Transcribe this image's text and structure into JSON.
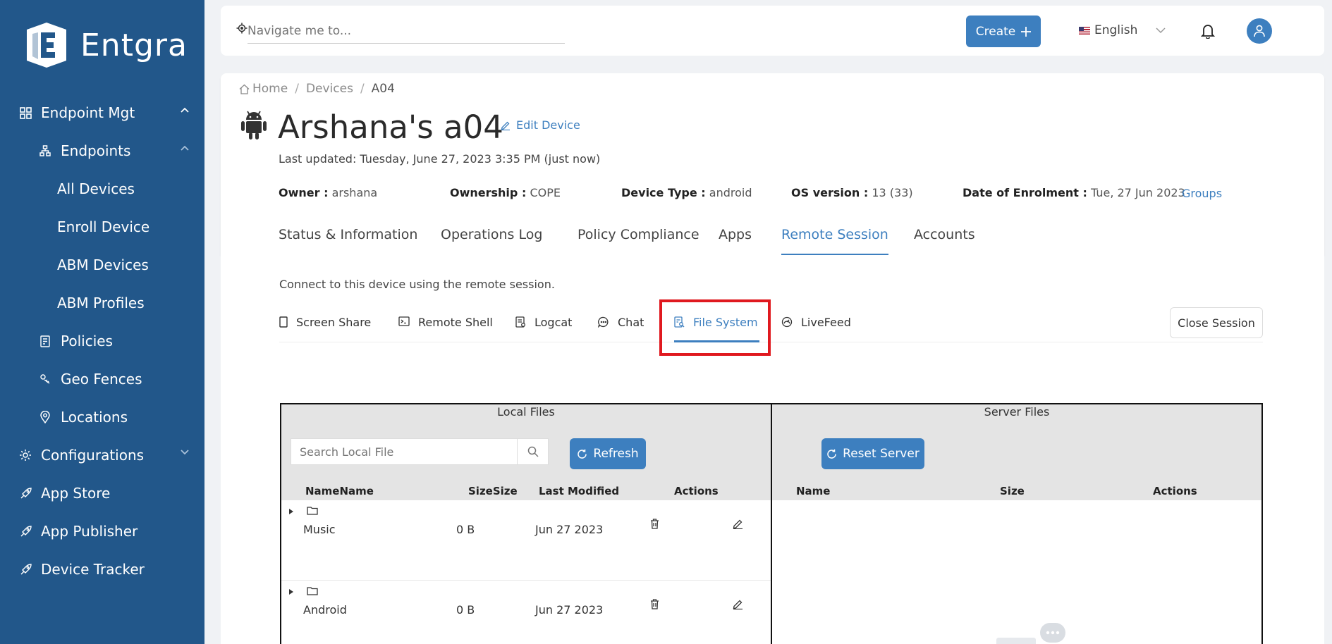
{
  "brand": {
    "name": "Entgra"
  },
  "sidebar": {
    "items": [
      {
        "label": "Endpoint Mgt",
        "icon": "grid-icon"
      },
      {
        "label": "Endpoints",
        "icon": "sitemap-icon"
      },
      {
        "label": "All Devices"
      },
      {
        "label": "Enroll Device"
      },
      {
        "label": "ABM Devices"
      },
      {
        "label": "ABM Profiles"
      },
      {
        "label": "Policies",
        "icon": "policy-icon"
      },
      {
        "label": "Geo Fences",
        "icon": "geofence-icon"
      },
      {
        "label": "Locations",
        "icon": "location-pin-icon"
      },
      {
        "label": "Configurations",
        "icon": "gear-icon"
      },
      {
        "label": "App Store",
        "icon": "rocket-icon"
      },
      {
        "label": "App Publisher",
        "icon": "rocket-icon"
      },
      {
        "label": "Device Tracker",
        "icon": "rocket-icon"
      }
    ]
  },
  "topbar": {
    "search_placeholder": "Navigate me to...",
    "create_label": "Create",
    "language": "English"
  },
  "breadcrumb": {
    "home": "Home",
    "devices": "Devices",
    "current": "A04"
  },
  "device": {
    "title": "Arshana's a04",
    "edit_label": "Edit Device",
    "last_updated": "Last updated: Tuesday, June 27, 2023 3:35 PM (just now)",
    "owner_label": "Owner :",
    "owner": "arshana",
    "ownership_label": "Ownership :",
    "ownership": "COPE",
    "type_label": "Device Type :",
    "type": "android",
    "os_label": "OS version :",
    "os": "13 (33)",
    "enrolment_label": "Date of Enrolment :",
    "enrolment": "Tue, 27 Jun 2023",
    "groups_label": "Groups"
  },
  "tabs": [
    "Status & Information",
    "Operations Log",
    "Policy Compliance",
    "Apps",
    "Remote Session",
    "Accounts"
  ],
  "active_tab": "Remote Session",
  "session": {
    "description": "Connect to this device using the remote session.",
    "sub_tabs": [
      "Screen Share",
      "Remote Shell",
      "Logcat",
      "Chat",
      "File System",
      "LiveFeed"
    ],
    "active_sub_tab": "File System",
    "close_label": "Close Session"
  },
  "local_files": {
    "title": "Local Files",
    "search_placeholder": "Search Local File",
    "refresh_label": "Refresh",
    "columns": [
      "NameName",
      "SizeSize",
      "Last Modified",
      "Actions"
    ],
    "rows": [
      {
        "name": "Music",
        "size": "0 B",
        "modified": "Jun 27 2023"
      },
      {
        "name": "Android",
        "size": "0 B",
        "modified": "Jun 27 2023"
      }
    ]
  },
  "server_files": {
    "title": "Server Files",
    "reset_label": "Reset Server",
    "columns": [
      "Name",
      "Size",
      "Actions"
    ]
  },
  "colors": {
    "sidebar": "#22578a",
    "accent": "#3d7fbf",
    "highlight": "#e0191f"
  }
}
